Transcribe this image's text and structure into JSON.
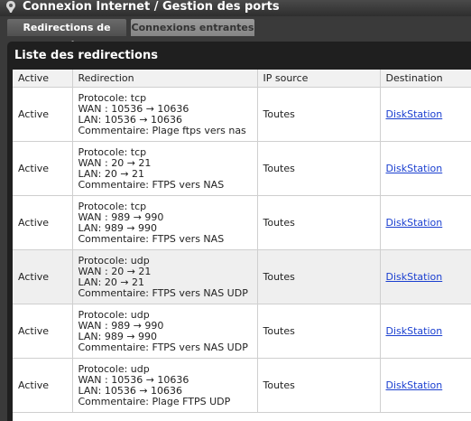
{
  "header": {
    "title": "Connexion Internet / Gestion des ports"
  },
  "tabs": [
    {
      "label": "Redirections de ports",
      "active": true
    },
    {
      "label": "Connexions entrantes",
      "active": false
    }
  ],
  "panel": {
    "title": "Liste des redirections"
  },
  "table": {
    "columns": [
      "Active",
      "Redirection",
      "IP source",
      "Destination"
    ],
    "rows": [
      {
        "active": "Active",
        "protocol": "Protocole: tcp",
        "wan": "WAN : 10536 → 10636",
        "lan": "LAN: 10536 → 10636",
        "comment": "Commentaire: Plage ftps vers nas",
        "ip_source": "Toutes",
        "destination": "DiskStation"
      },
      {
        "active": "Active",
        "protocol": "Protocole: tcp",
        "wan": "WAN : 20 → 21",
        "lan": "LAN: 20 → 21",
        "comment": "Commentaire: FTPS vers NAS",
        "ip_source": "Toutes",
        "destination": "DiskStation"
      },
      {
        "active": "Active",
        "protocol": "Protocole: tcp",
        "wan": "WAN : 989 → 990",
        "lan": "LAN: 989 → 990",
        "comment": "Commentaire: FTPS vers NAS",
        "ip_source": "Toutes",
        "destination": "DiskStation"
      },
      {
        "active": "Active",
        "protocol": "Protocole: udp",
        "wan": "WAN : 20 → 21",
        "lan": "LAN: 20 → 21",
        "comment": "Commentaire: FTPS vers NAS UDP",
        "ip_source": "Toutes",
        "destination": "DiskStation"
      },
      {
        "active": "Active",
        "protocol": "Protocole: udp",
        "wan": "WAN : 989 → 990",
        "lan": "LAN: 989 → 990",
        "comment": "Commentaire: FTPS vers NAS UDP",
        "ip_source": "Toutes",
        "destination": "DiskStation"
      },
      {
        "active": "Active",
        "protocol": "Protocole: udp",
        "wan": "WAN : 10536 → 10636",
        "lan": "LAN: 10536 → 10636",
        "comment": "Commentaire: Plage FTPS UDP",
        "ip_source": "Toutes",
        "destination": "DiskStation"
      }
    ]
  }
}
